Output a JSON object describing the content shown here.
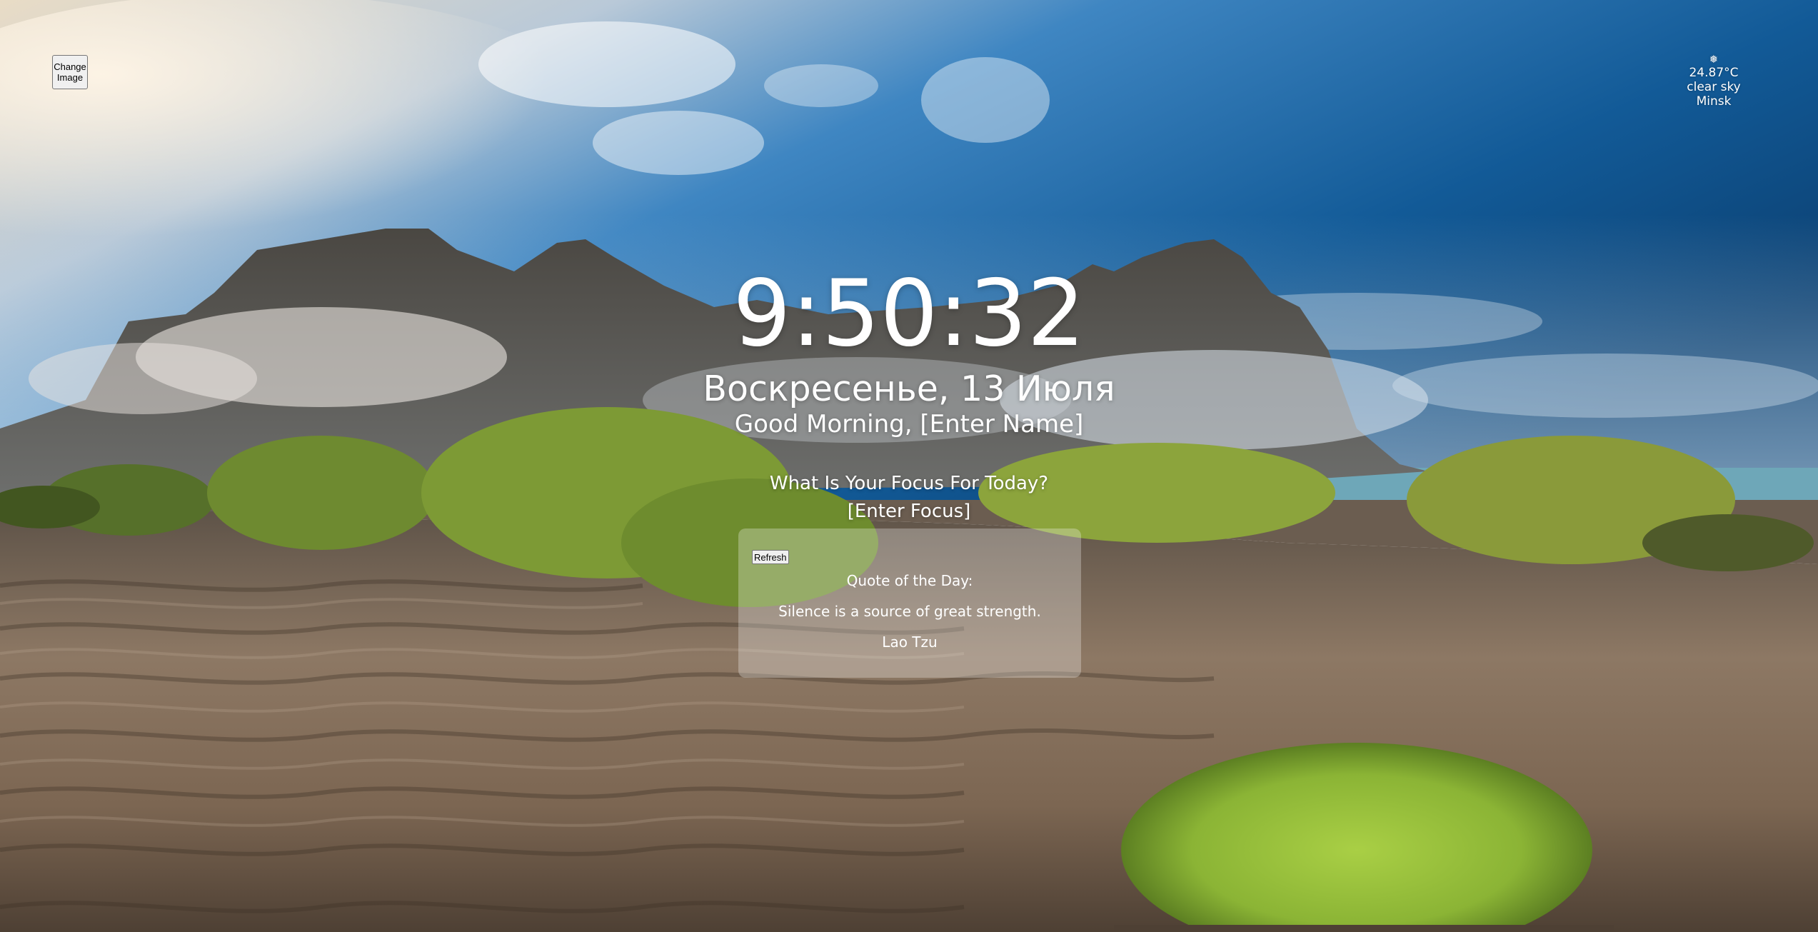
{
  "controls": {
    "change_image_label": "Change Image",
    "refresh_label": "Refresh"
  },
  "weather": {
    "icon": "weather-icon",
    "temperature": "24.87°C",
    "description": "clear sky",
    "city": "Minsk"
  },
  "clock": {
    "time": "9:50:32"
  },
  "date": {
    "text": "Воскресенье, 13 Июля"
  },
  "greeting": {
    "prefix": "Good Morning, ",
    "name": "[Enter Name]"
  },
  "focus": {
    "question": "What Is Your Focus For Today?",
    "value": "[Enter Focus]"
  },
  "quote": {
    "title": "Quote of the Day:",
    "text": "Silence is a source of great strength.",
    "author": "Lao Tzu"
  },
  "colors": {
    "sky_top": "#0e4f88",
    "sand": "#8a7560",
    "grass": "#8fb53a",
    "moss": "#93c23a"
  }
}
